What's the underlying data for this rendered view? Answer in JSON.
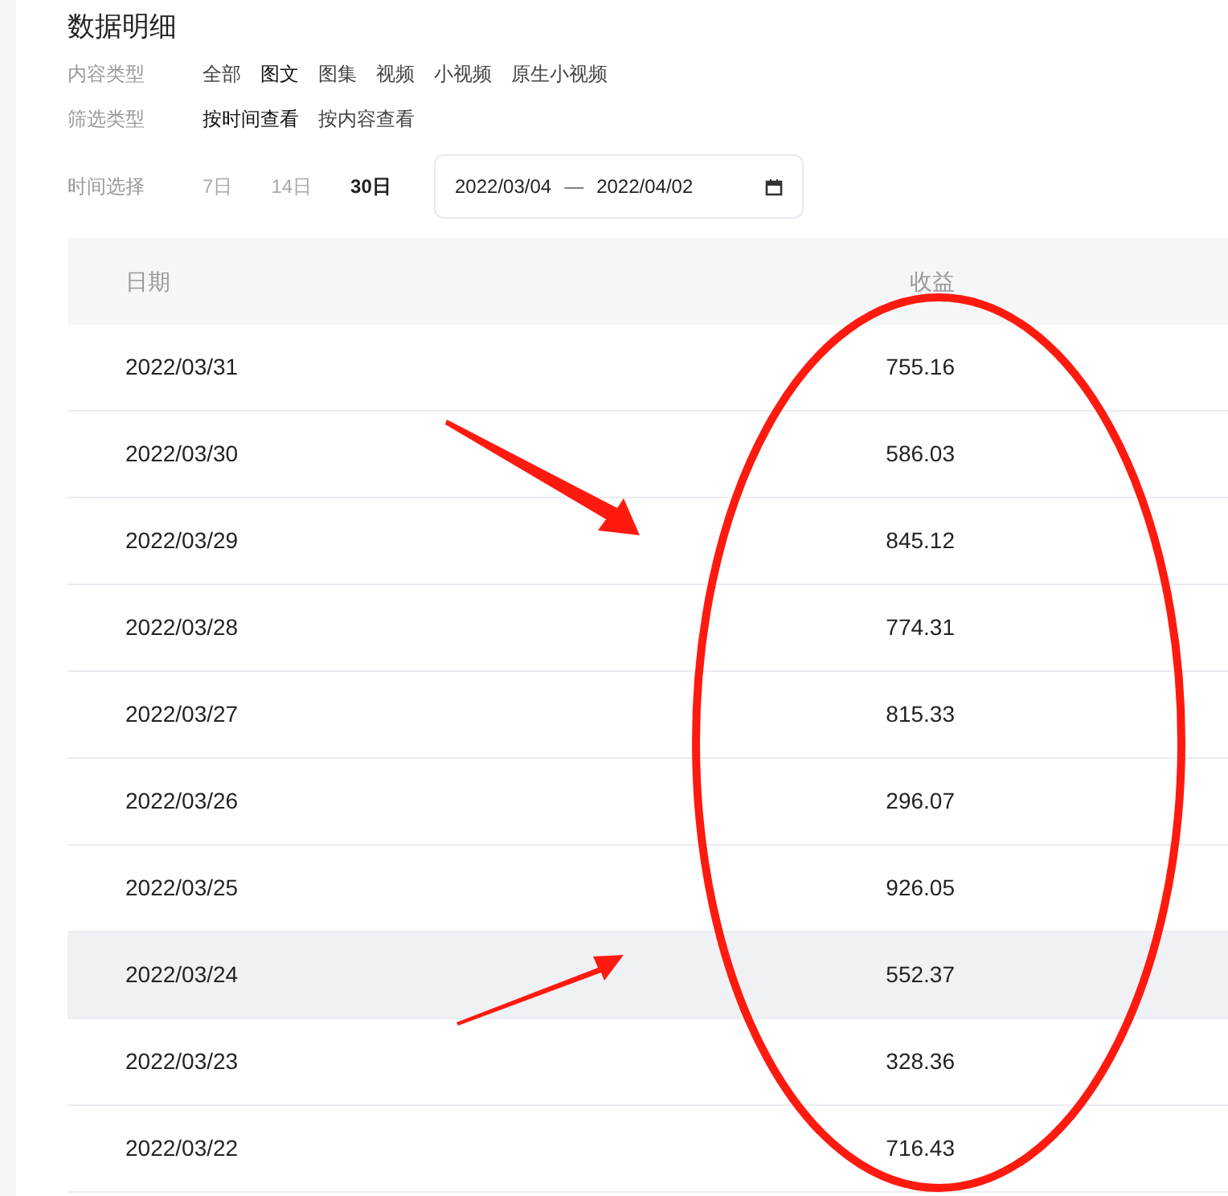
{
  "title": "数据明细",
  "filters": [
    {
      "label": "内容类型",
      "options": [
        {
          "text": "全部",
          "selected": false
        },
        {
          "text": "图文",
          "selected": true
        },
        {
          "text": "图集",
          "selected": false
        },
        {
          "text": "视频",
          "selected": false
        },
        {
          "text": "小视频",
          "selected": false
        },
        {
          "text": "原生小视频",
          "selected": false
        }
      ]
    },
    {
      "label": "筛选类型",
      "options": [
        {
          "text": "按时间查看",
          "selected": true
        },
        {
          "text": "按内容查看",
          "selected": false
        }
      ]
    }
  ],
  "time": {
    "label": "时间选择",
    "options": [
      {
        "text": "7日",
        "selected": false
      },
      {
        "text": "14日",
        "selected": false
      },
      {
        "text": "30日",
        "selected": true
      }
    ],
    "start": "2022/03/04",
    "separator": "—",
    "end": "2022/04/02"
  },
  "table": {
    "columns": [
      "日期",
      "收益"
    ],
    "rows": [
      {
        "date": "2022/03/31",
        "value": "755.16",
        "hovered": false
      },
      {
        "date": "2022/03/30",
        "value": "586.03",
        "hovered": false
      },
      {
        "date": "2022/03/29",
        "value": "845.12",
        "hovered": false
      },
      {
        "date": "2022/03/28",
        "value": "774.31",
        "hovered": false
      },
      {
        "date": "2022/03/27",
        "value": "815.33",
        "hovered": false
      },
      {
        "date": "2022/03/26",
        "value": "296.07",
        "hovered": false
      },
      {
        "date": "2022/03/25",
        "value": "926.05",
        "hovered": false
      },
      {
        "date": "2022/03/24",
        "value": "552.37",
        "hovered": true
      },
      {
        "date": "2022/03/23",
        "value": "328.36",
        "hovered": false
      },
      {
        "date": "2022/03/22",
        "value": "716.43",
        "hovered": false
      }
    ]
  }
}
